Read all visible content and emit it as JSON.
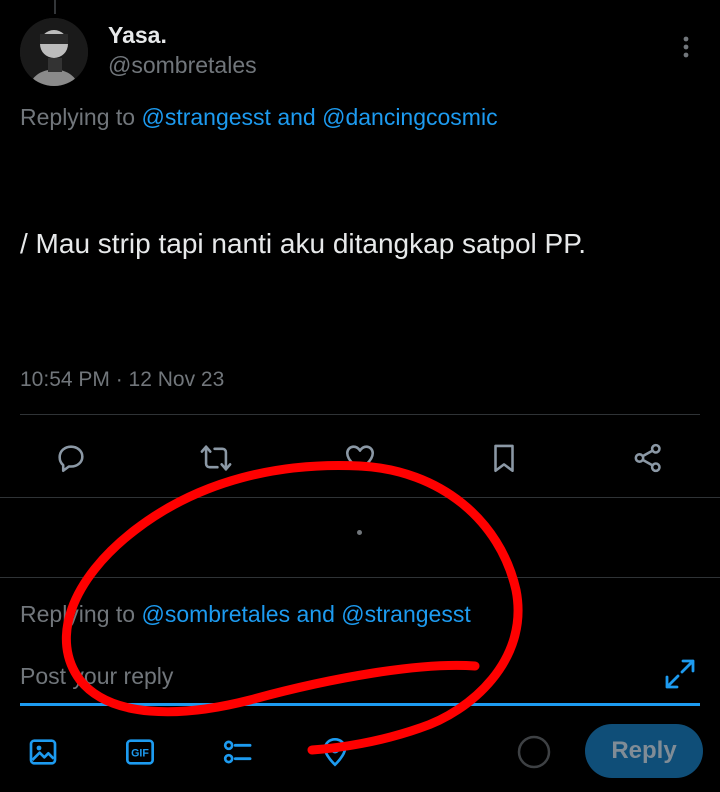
{
  "tweet": {
    "display_name": "Yasa.",
    "handle": "@sombretales",
    "replying_prefix": "Replying to ",
    "replying_mention_1": "@strangesst",
    "replying_conj": " and ",
    "replying_mention_2": "@dancingcosmic",
    "text": "/ Mau strip tapi nanti aku ditangkap satpol PP.",
    "timestamp": "10:54 PM · 12 Nov 23"
  },
  "actions": [
    {
      "icon": "reply-icon"
    },
    {
      "icon": "retweet-icon"
    },
    {
      "icon": "like-icon"
    },
    {
      "icon": "bookmark-icon"
    },
    {
      "icon": "share-icon"
    }
  ],
  "composer": {
    "replying_prefix": "Replying to ",
    "replying_mention_1": "@sombretales",
    "replying_conj": " and ",
    "replying_mention_2": "@strangesst",
    "placeholder": "Post your reply",
    "reply_label": "Reply",
    "tools": [
      "image-icon",
      "gif-icon",
      "poll-icon",
      "location-icon"
    ]
  },
  "colors": {
    "accent": "#1d9bf0",
    "muted": "#71767b",
    "annotation": "#ff0000"
  }
}
